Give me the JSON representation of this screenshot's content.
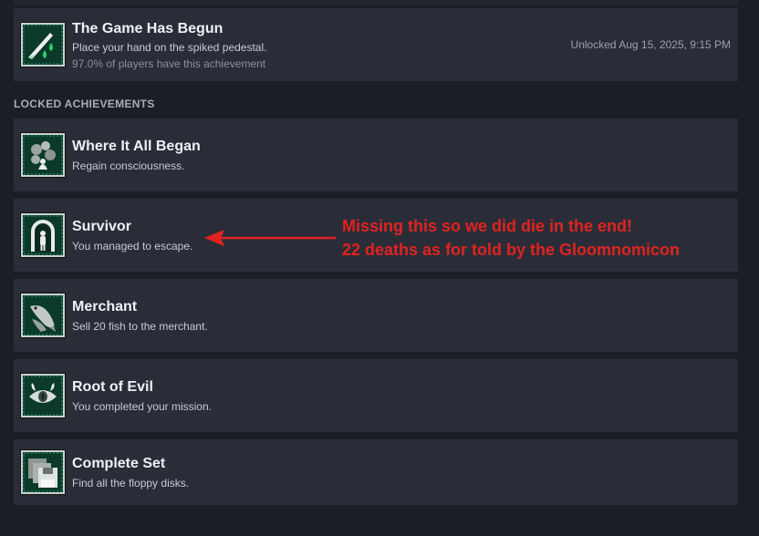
{
  "unlocked": [
    {
      "title": "The Game Has Begun",
      "description": "Place your hand on the spiked pedestal.",
      "percent": "97.0% of players have this achievement",
      "unlocked_at": "Unlocked Aug 15, 2025, 9:15 PM",
      "icon": "blade-drops-icon"
    }
  ],
  "locked_header": "LOCKED ACHIEVEMENTS",
  "locked": [
    {
      "title": "Where It All Began",
      "description": "Regain consciousness.",
      "icon": "rubble-icon"
    },
    {
      "title": "Survivor",
      "description": "You managed to escape.",
      "icon": "doorway-figure-icon"
    },
    {
      "title": "Merchant",
      "description": "Sell 20 fish to the merchant.",
      "icon": "fish-icon"
    },
    {
      "title": "Root of Evil",
      "description": "You completed your mission.",
      "icon": "horned-eye-icon"
    },
    {
      "title": "Complete Set",
      "description": "Find all the floppy disks.",
      "icon": "floppy-disks-icon"
    }
  ],
  "annotation": {
    "line1": "Missing this so we did die in the end!",
    "line2": "22 deaths as for told by the Gloomnomicon",
    "color": "#e0231f"
  },
  "colors": {
    "background": "#1b1e26",
    "card": "#2a2d38",
    "icon_bg": "#0b3a2b"
  }
}
